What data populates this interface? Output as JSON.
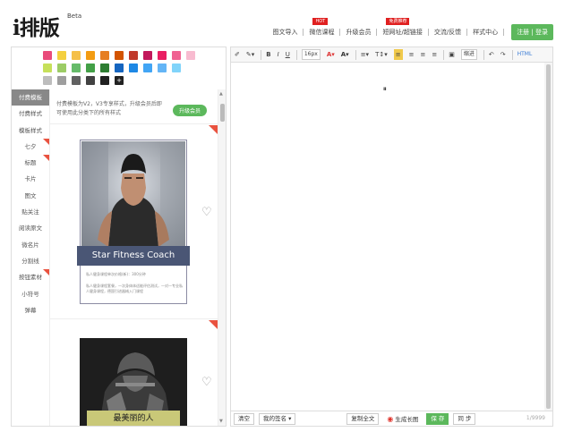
{
  "header": {
    "logo": "i排版",
    "beta": "Beta",
    "nav": [
      {
        "label": "图文导入",
        "badge": ""
      },
      {
        "label": "微信课程",
        "badge": "HOT"
      },
      {
        "label": "升级会员",
        "badge": ""
      },
      {
        "label": "短网址/超链接",
        "badge": "免费推荐"
      },
      {
        "label": "交流/反馈",
        "badge": ""
      },
      {
        "label": "样式中心",
        "badge": ""
      }
    ],
    "login": "注册 | 登录"
  },
  "palette": {
    "row1": [
      "#e94b7b",
      "#f4d03f",
      "#f5c04a",
      "#f39c12",
      "#e67e22",
      "#d35400",
      "#c0392b",
      "#c2185b",
      "#e91e63",
      "#f06292",
      "#f8bbd0"
    ],
    "row2": [
      "#c6e05a",
      "#9ccc65",
      "#66bb6a",
      "#43a047",
      "#2e7d32",
      "#1565c0",
      "#1e88e5",
      "#42a5f5",
      "#64b5f6",
      "#81d4fa"
    ],
    "row3": [
      "#bdbdbd",
      "#9e9e9e",
      "#616161",
      "#424242",
      "#212121"
    ],
    "plus": "+"
  },
  "sidebar": {
    "items": [
      "付费模板",
      "付费样式",
      "模板样式",
      "七夕",
      "标题",
      "卡片",
      "图文",
      "贴关注",
      "阅读原文",
      "微名片",
      "分割线",
      "按钮素材",
      "小符号",
      "弹幕"
    ]
  },
  "content": {
    "notice": "付费模板为V2，V3专享样式，升级会员后即可使用此分类下的所有样式",
    "upgrade": "升级会员",
    "card1_title": "Star Fitness Coach",
    "card1_line1": "私人健身课程单次价格(新)：300分钟",
    "card1_line2": "私人健身课程套餐，一次身体体适能评估测试，一对一专业私人健身课程，德国引进器械入门课程",
    "card2_label": "最美丽的人",
    "heart": "♡"
  },
  "toolbar": {
    "eraser": "✐",
    "pen": "✎▾",
    "bold": "B",
    "italic": "I",
    "underline": "U",
    "fontsize": "16px",
    "fontcolor": "A▾",
    "bgcolor": "A▾",
    "list": "≡▾",
    "text": "T↕▾",
    "align_left": "≡",
    "align_center": "≡",
    "align_right": "≡",
    "justify": "≡",
    "image": "▣",
    "indent": "缩进",
    "undo": "↶",
    "redo": "↷",
    "html": "HTML"
  },
  "editor": {
    "loading": "ıııı"
  },
  "bottom": {
    "clear": "清空",
    "signature": "我的签名 ▾",
    "copy": "复制全文",
    "longimg": "生成长图",
    "save": "保 存",
    "sync": "同 步",
    "counter": "1/9999"
  }
}
